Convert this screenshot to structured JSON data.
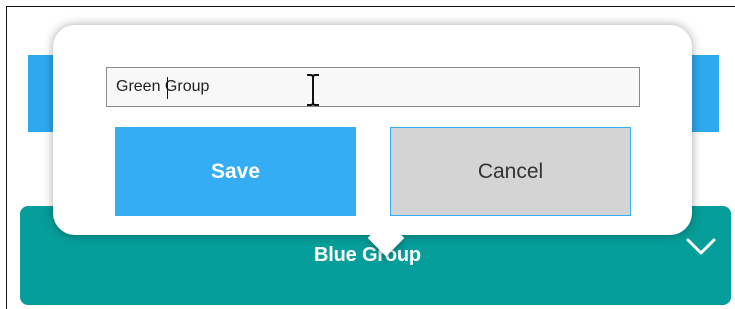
{
  "group": {
    "title": "Blue Group",
    "bar_color": "#069e9a",
    "expand_icon": "chevron-down-icon"
  },
  "rename_popup": {
    "input_value": "Green Group",
    "save_label": "Save",
    "cancel_label": "Cancel",
    "save_color": "#35adf5",
    "cancel_color": "#d4d4d4",
    "cursor_icon": "text-cursor-icon"
  },
  "background": {
    "accent_color": "#2ea9f0"
  }
}
